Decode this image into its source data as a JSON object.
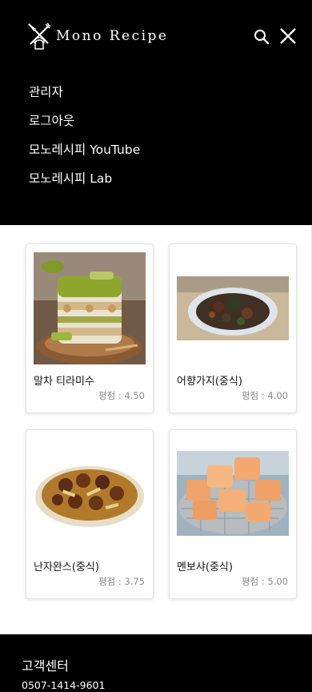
{
  "header": {
    "logo_text": "Mono Recipe",
    "icons": [
      "chef-knife-fork-icon",
      "search-icon",
      "close-icon"
    ]
  },
  "menu": [
    {
      "label": "관리자"
    },
    {
      "label": "로그아웃"
    },
    {
      "label": "모노레시피 YouTube"
    },
    {
      "label": "모노레시피 Lab"
    }
  ],
  "recipes": [
    {
      "name": "말차 티라미수",
      "rating": "평점 : 4.50",
      "image": "matcha-tiramisu-photo"
    },
    {
      "name": "어향가지(중식)",
      "rating": "평점 : 4.00",
      "image": "fish-fragrant-eggplant-photo"
    },
    {
      "name": "난자완스(중식)",
      "rating": "평점 : 3.75",
      "image": "nanjawanseu-meatball-photo"
    },
    {
      "name": "멘보샤(중식)",
      "rating": "평점 : 5.00",
      "image": "menbosha-shrimp-toast-photo"
    }
  ],
  "footer": {
    "title": "고객센터",
    "phone": "0507-1414-9601"
  },
  "colors": {
    "header_bg": "#000000",
    "footer_bg": "#000000",
    "rating_text": "#8a8a8a"
  }
}
